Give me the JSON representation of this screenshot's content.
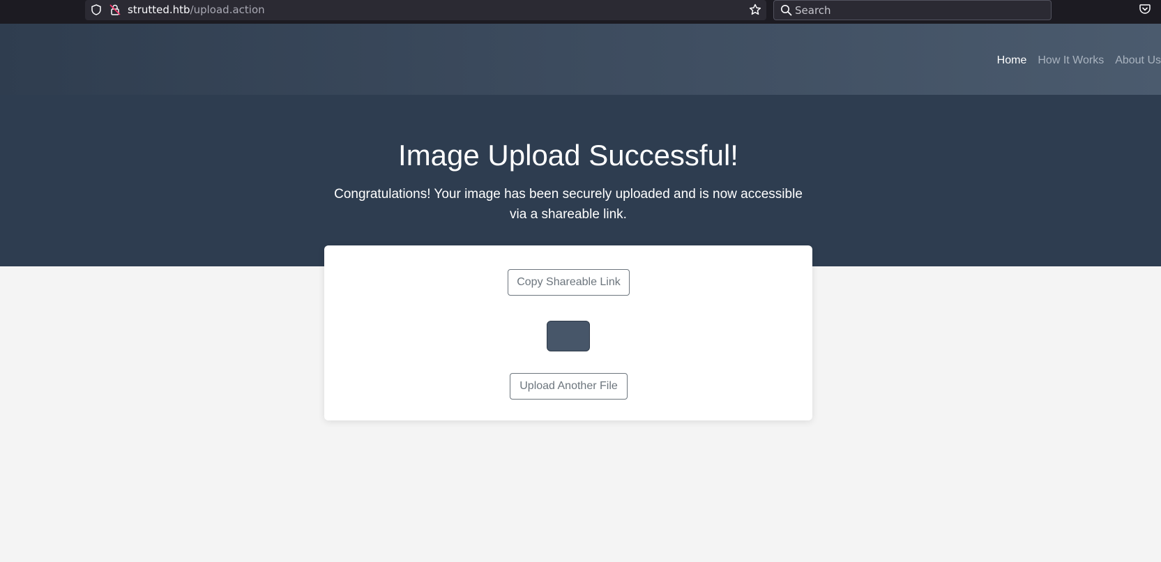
{
  "browser": {
    "url_host": "strutted.htb",
    "url_path": "/upload.action",
    "search_placeholder": "Search"
  },
  "nav": {
    "items": [
      "Home",
      "How It Works",
      "About Us"
    ],
    "active": "Home"
  },
  "hero": {
    "title": "Image Upload Successful!",
    "message": "Congratulations! Your image has been securely uploaded and is now accessible via a shareable link."
  },
  "card": {
    "copy_label": "Copy Shareable Link",
    "upload_label": "Upload Another File"
  },
  "colors": {
    "hero_bg": "#2e3d50",
    "page_bg": "#f4f4f4",
    "thumb": "#475669"
  }
}
